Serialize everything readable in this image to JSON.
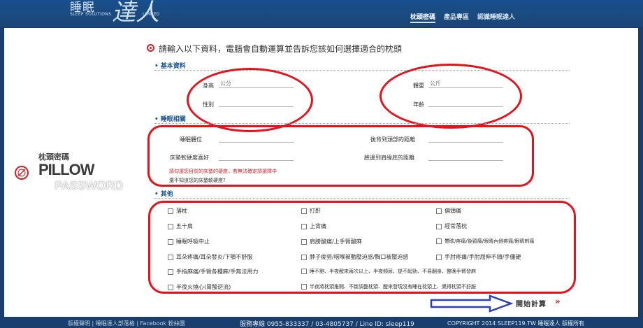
{
  "header": {
    "logo_cn": "睡眠",
    "logo_big": "達人",
    "logo_sub": "SLEEP SOLUTIONS",
    "logo_ltd": "LIMITED",
    "nav": [
      "枕頭密碼",
      "產品專區",
      "認識睡眠達人"
    ]
  },
  "brand": {
    "pillow_cn": "枕頭密碼",
    "pillow_en": "PILLOW",
    "pillow_pw": "PASSWORD",
    "icon": "compass-icon"
  },
  "form": {
    "heading": "請輸入以下資料，電腦會自動運算並告訴您該如何選擇適合的枕頭",
    "section_basic": "基本資料",
    "section_sleep": "睡眠相關",
    "section_other": "其他",
    "basic": {
      "height_label": "身高",
      "height_unit": "公分",
      "weight_label": "體重",
      "weight_unit": "公斤",
      "gender_label": "性別",
      "age_label": "年齡"
    },
    "sleep": {
      "position_label": "睡眠體位",
      "back_head_label": "後背到頭部的距離",
      "mattress_label": "床墊軟硬度喜好",
      "neck_shoulder_label": "臉邊到肩緣底的距離",
      "note_line1": "請勾選您目前的床墊的硬度，若無法確定請選擇中",
      "note_line2": "還不知道您的床墊軟硬度?"
    },
    "other_items": [
      "落枕",
      "打鼾",
      "偏頭痛",
      "五十肩",
      "上背痛",
      "經常落枕",
      "睡眠呼吸中止",
      "肩膀酸痛/上手臂酸麻",
      "暈眩/疼痛/後頸痛/眼睛內側疼痛/眼睛刺痛",
      "耳朵疼痛/耳朵發炎/下顎不舒服",
      "脖子痠勞/咽喉被動壓迫感/胸口被壓迫感",
      "手肘疼痛/手肘屈伸不順/手僵硬",
      "手指麻痛/手臂各種麻/手無法用力",
      "睡不飽、半夜醒來兩次以上、半夜頻尿、提不起勁、不易翻身、整晚手臂發麻",
      "半夜火燒心(胃酸逆流)",
      "半夜將枕頭推開、不斷調整枕頭、醒來發現沒有睡在枕頭上、覺得枕頭不舒服"
    ],
    "start_label": "開始計算",
    "start_chevron": "»"
  },
  "footer": {
    "left": "版權聲明 | 睡眠達人部落格 | Facebook 粉絲團",
    "middle": "服務專線 0955-833337 / 03-4805737 / Line ID: sleep119",
    "right": "COPYRIGHT 2014 SLEEP119.TW 睡眠達人 版權所有"
  },
  "colors": {
    "background": "#1a3e6e",
    "accent_red": "#e8101b",
    "arrow_blue": "#2b3fbf",
    "section_blue": "#1d5694"
  }
}
